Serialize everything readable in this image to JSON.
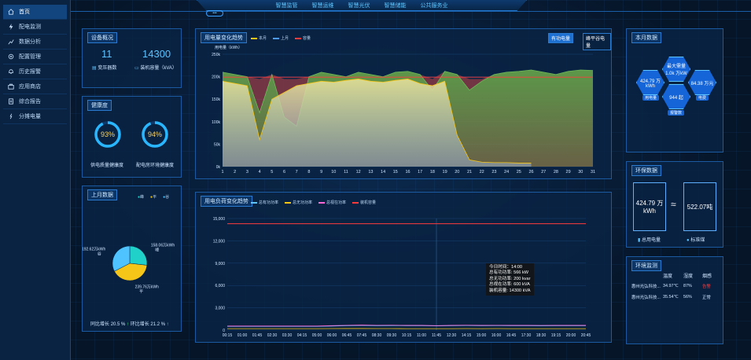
{
  "topnav": {
    "tabs": [
      "智慧监管",
      "智慧运维",
      "智慧光伏",
      "智慧储能",
      "公共服务业"
    ],
    "pill": ""
  },
  "sidebar": {
    "items": [
      {
        "label": "首页",
        "icon": "home-icon",
        "active": true
      },
      {
        "label": "配电监测",
        "icon": "bolt-icon"
      },
      {
        "label": "数据分析",
        "icon": "chart-icon"
      },
      {
        "label": "配置管理",
        "icon": "gear-icon"
      },
      {
        "label": "历史报警",
        "icon": "bell-icon"
      },
      {
        "label": "应用商店",
        "icon": "store-icon"
      },
      {
        "label": "综合报告",
        "icon": "report-icon"
      },
      {
        "label": "分摊电量",
        "icon": "share-icon"
      }
    ]
  },
  "overview": {
    "title": "设备概况",
    "transformer_count": "11",
    "transformer_label": "变压器数",
    "capacity": "14300",
    "capacity_label": "装机容量（kVA）"
  },
  "health": {
    "title": "健康度",
    "supply": {
      "value": "93%",
      "label": "供电质量健康度",
      "fraction": 0.93
    },
    "env": {
      "value": "94%",
      "label": "配电房环境健康度",
      "fraction": 0.94
    }
  },
  "last_month": {
    "title": "上月数据",
    "legend": [
      "峰",
      "平",
      "谷"
    ],
    "slices": [
      {
        "name": "峰",
        "label": "158.06万kWh",
        "sub": "峰",
        "value": 158.06,
        "color": "#1fd1c8"
      },
      {
        "name": "平",
        "label": "239.76万kWh",
        "sub": "平",
        "value": 239.76,
        "color": "#f5c518"
      },
      {
        "name": "谷",
        "label": "192.62万kWh",
        "sub": "谷",
        "value": 192.62,
        "color": "#4ec3ff"
      }
    ],
    "yoy_label": "同比增长",
    "yoy": "20.5 %",
    "mom_label": "环比增长",
    "mom": "21.2 %"
  },
  "energy_chart": {
    "title": "用电量变化趋势",
    "btn_active": "有功电量",
    "btn_other": "峰平谷电量",
    "unit": "用电量（kWh）",
    "legend": [
      {
        "name": "本月",
        "color": "#f5c518"
      },
      {
        "name": "上月",
        "color": "#4e9bff"
      },
      {
        "name": "容量",
        "color": "#ff3b3b"
      }
    ]
  },
  "load_chart": {
    "title": "用电负荷变化趋势",
    "legend": [
      {
        "name": "总有功功率",
        "color": "#5fc6ff"
      },
      {
        "name": "总无功功率",
        "color": "#f5c518"
      },
      {
        "name": "总视在功率",
        "color": "#ff6ad5"
      },
      {
        "name": "装机容量",
        "color": "#ff3b3b"
      }
    ],
    "tooltip": [
      "今日时间：14:00",
      "总有功功率: 566 kW",
      "总无功功率: 200 kvar",
      "总视在功率: 600 kVA",
      "装机容量: 14300 kVA"
    ]
  },
  "this_month": {
    "title": "本月数据",
    "center_label": "最大需量",
    "center_value": "1.0k 万kW",
    "left_value": "424.79 万kWh",
    "left_label": "用电量",
    "right_value": "84.38 万元",
    "right_label": "电费",
    "bottom_value": "944 起",
    "bottom_label": "报警数"
  },
  "env_data": {
    "title": "环保数据",
    "left_value": "424.79 万kWh",
    "approx": "≈",
    "right_value": "522.07吨",
    "left_label": "总用电量",
    "right_label": "标准煤"
  },
  "env_monitor": {
    "title": "环境监测",
    "headers": [
      "温度",
      "湿度",
      "烟感"
    ],
    "rows": [
      {
        "name": "惠州光弘科技...",
        "temp": "34.97℃",
        "hum": "87%",
        "smoke": "告警",
        "smoke_color": "#ff3b3b"
      },
      {
        "name": "惠州光弘科技...",
        "temp": "35.54℃",
        "hum": "56%",
        "smoke": "正常",
        "smoke_color": "#cfe6ff"
      }
    ]
  },
  "chart_data": [
    {
      "type": "area",
      "title": "用电量变化趋势",
      "ylabel": "用电量（kWh）",
      "x": [
        1,
        2,
        3,
        4,
        5,
        6,
        7,
        8,
        9,
        10,
        11,
        12,
        13,
        14,
        15,
        16,
        17,
        18,
        19,
        20,
        21,
        22,
        23,
        24,
        25,
        26,
        27,
        28,
        29,
        30,
        31
      ],
      "ylim": [
        0,
        250000
      ],
      "yticks": [
        "0k",
        "50k",
        "100k",
        "150k",
        "200k",
        "250k"
      ],
      "series": [
        {
          "name": "本月",
          "values": [
            190000,
            185000,
            180000,
            60000,
            150000,
            165000,
            180000,
            185000,
            190000,
            188000,
            192000,
            195000,
            190000,
            188000,
            192000,
            195000,
            185000,
            180000,
            190000,
            70000,
            15000,
            10000,
            9000,
            9000,
            8000,
            8000,
            null,
            null,
            null,
            null,
            null
          ]
        },
        {
          "name": "上月",
          "values": [
            210000,
            205000,
            200000,
            120000,
            205000,
            110000,
            90000,
            200000,
            210000,
            205000,
            200000,
            210000,
            205000,
            200000,
            210000,
            212000,
            205000,
            170000,
            212000,
            205000,
            170000,
            190000,
            205000,
            210000,
            212000,
            215000,
            210000,
            205000,
            212000,
            215000,
            214000
          ]
        },
        {
          "name": "容量",
          "values": [
            199000,
            199000,
            199000,
            199000,
            199000,
            199000,
            199000,
            199000,
            199000,
            199000,
            199000,
            199000,
            199000,
            199000,
            199000,
            199000,
            199000,
            199000,
            199000,
            199000,
            199000,
            199000,
            199000,
            199000,
            199000,
            199000,
            199000,
            199000,
            199000,
            199000,
            199000
          ]
        }
      ]
    },
    {
      "type": "line",
      "title": "用电负荷变化趋势",
      "x": [
        "00:15",
        "01:00",
        "01:45",
        "02:30",
        "03:30",
        "04:15",
        "05:00",
        "06:00",
        "06:45",
        "07:45",
        "08:30",
        "09:30",
        "10:15",
        "11:00",
        "11:45",
        "12:30",
        "14:15",
        "15:00",
        "16:00",
        "16:45",
        "17:30",
        "18:30",
        "19:15",
        "20:00",
        "20:45"
      ],
      "ylim": [
        0,
        15000
      ],
      "yticks": [
        "0",
        "3,000",
        "6,000",
        "9,000",
        "12,000",
        "15,000"
      ],
      "series": [
        {
          "name": "总有功功率",
          "values": [
            500,
            500,
            500,
            500,
            500,
            500,
            500,
            550,
            600,
            620,
            600,
            610,
            600,
            600,
            566,
            600,
            620,
            600,
            610,
            600,
            600,
            590,
            600,
            600,
            600
          ]
        },
        {
          "name": "总无功功率",
          "values": [
            200,
            200,
            200,
            200,
            200,
            200,
            200,
            210,
            220,
            220,
            210,
            210,
            200,
            200,
            200,
            200,
            210,
            200,
            210,
            200,
            200,
            200,
            200,
            200,
            200
          ]
        },
        {
          "name": "总视在功率",
          "values": [
            550,
            550,
            550,
            550,
            550,
            550,
            550,
            600,
            650,
            680,
            650,
            660,
            640,
            640,
            600,
            640,
            660,
            640,
            650,
            640,
            640,
            630,
            640,
            640,
            640
          ]
        },
        {
          "name": "装机容量",
          "values": [
            14300,
            14300,
            14300,
            14300,
            14300,
            14300,
            14300,
            14300,
            14300,
            14300,
            14300,
            14300,
            14300,
            14300,
            14300,
            14300,
            14300,
            14300,
            14300,
            14300,
            14300,
            14300,
            14300,
            14300,
            14300
          ]
        }
      ]
    },
    {
      "type": "pie",
      "title": "上月数据",
      "categories": [
        "峰",
        "平",
        "谷"
      ],
      "values": [
        158.06,
        239.76,
        192.62
      ]
    }
  ]
}
